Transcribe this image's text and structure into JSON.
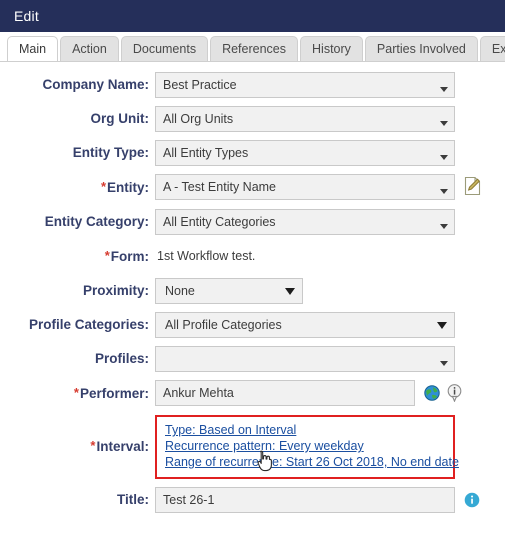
{
  "window": {
    "title": "Edit",
    "header_bg": "#252f5a"
  },
  "tabs": [
    {
      "label": "Main",
      "active": true
    },
    {
      "label": "Action",
      "active": false
    },
    {
      "label": "Documents",
      "active": false
    },
    {
      "label": "References",
      "active": false
    },
    {
      "label": "History",
      "active": false
    },
    {
      "label": "Parties Involved",
      "active": false
    },
    {
      "label": "Excel",
      "active": false
    }
  ],
  "form": {
    "required_marker": "*",
    "fields": {
      "company_name": {
        "label": "Company Name:",
        "value": "Best Practice"
      },
      "org_unit": {
        "label": "Org Unit:",
        "value": "All Org Units"
      },
      "entity_type": {
        "label": "Entity Type:",
        "value": "All Entity Types"
      },
      "entity": {
        "label": "Entity:",
        "value": "A - Test Entity Name"
      },
      "entity_category": {
        "label": "Entity Category:",
        "value": "All Entity Categories"
      },
      "form_name": {
        "label": "Form:",
        "value": "1st Workflow test."
      },
      "proximity": {
        "label": "Proximity:",
        "value": "None"
      },
      "profile_categories": {
        "label": "Profile Categories:",
        "value": "All Profile Categories"
      },
      "profiles": {
        "label": "Profiles:",
        "value": ""
      },
      "performer": {
        "label": "Performer:",
        "value": "Ankur Mehta"
      },
      "interval": {
        "label": "Interval:"
      },
      "title": {
        "label": "Title:",
        "value": "Test 26-1"
      }
    },
    "interval_lines": [
      "Type: Based on Interval",
      "Recurrence pattern: Every weekday",
      "Range of recurrence: Start 26 Oct 2018, No end date"
    ]
  },
  "colors": {
    "header_navy": "#252f5a",
    "label_navy": "#36406b",
    "required_red": "#d63b2f",
    "highlight_red": "#e02020",
    "link_blue": "#1b4fa0",
    "field_bg": "#f1f1f1",
    "info_blue": "#36a9d4"
  }
}
